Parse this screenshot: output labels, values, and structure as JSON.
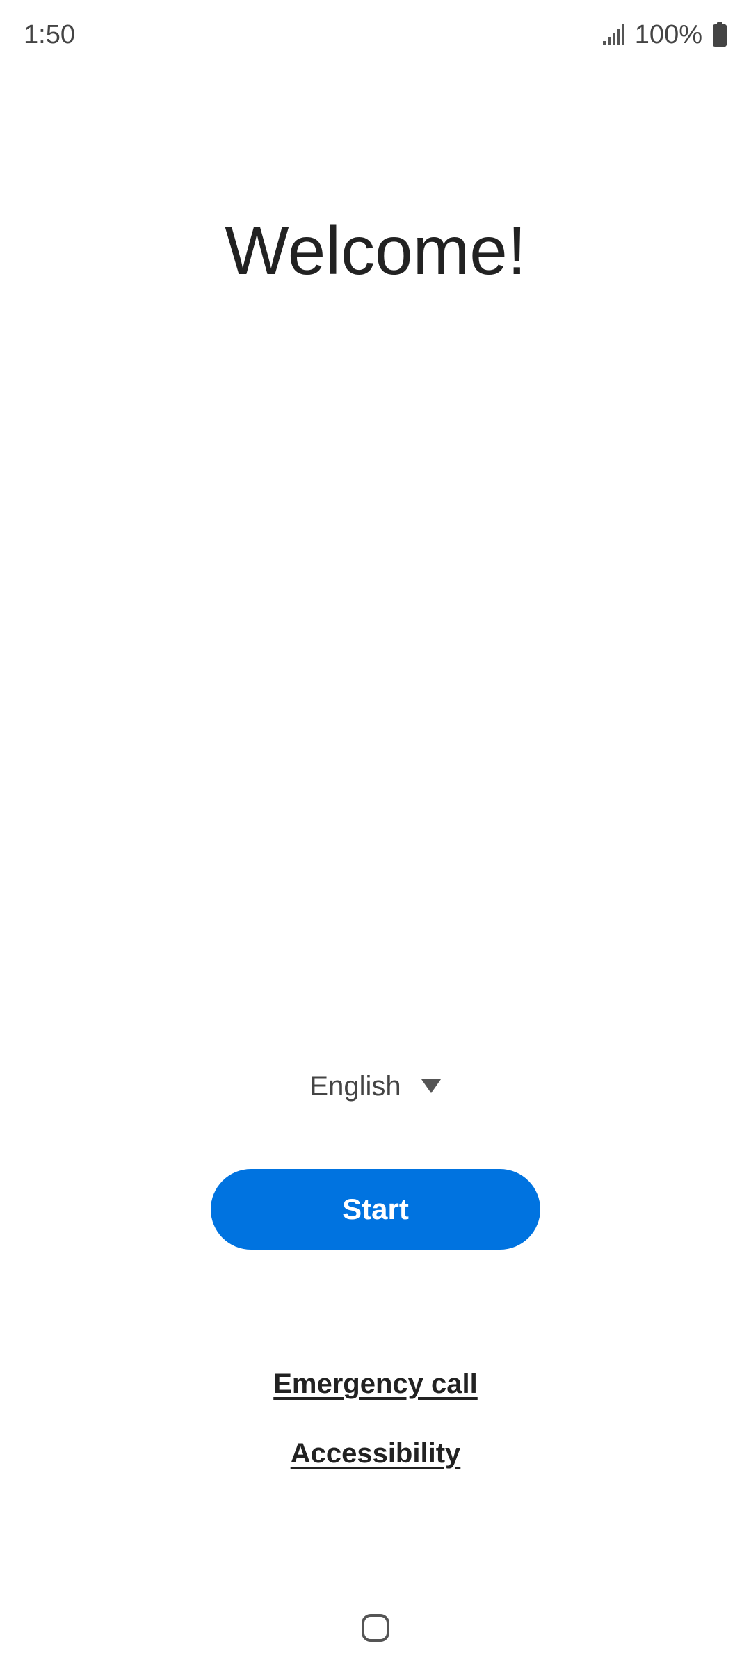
{
  "status_bar": {
    "time": "1:50",
    "battery_percent": "100%",
    "icons": [
      "signal-icon",
      "battery-icon"
    ]
  },
  "main": {
    "title": "Welcome!",
    "language": {
      "selected": "English",
      "icon": "caret-down-icon"
    },
    "start_label": "Start",
    "links": {
      "emergency_call": "Emergency call",
      "accessibility": "Accessibility"
    }
  },
  "nav_bar": {
    "icon": "home-icon"
  },
  "colors": {
    "accent": "#0073e0",
    "text": "#222222",
    "secondary_text": "#444444",
    "background": "#ffffff"
  }
}
